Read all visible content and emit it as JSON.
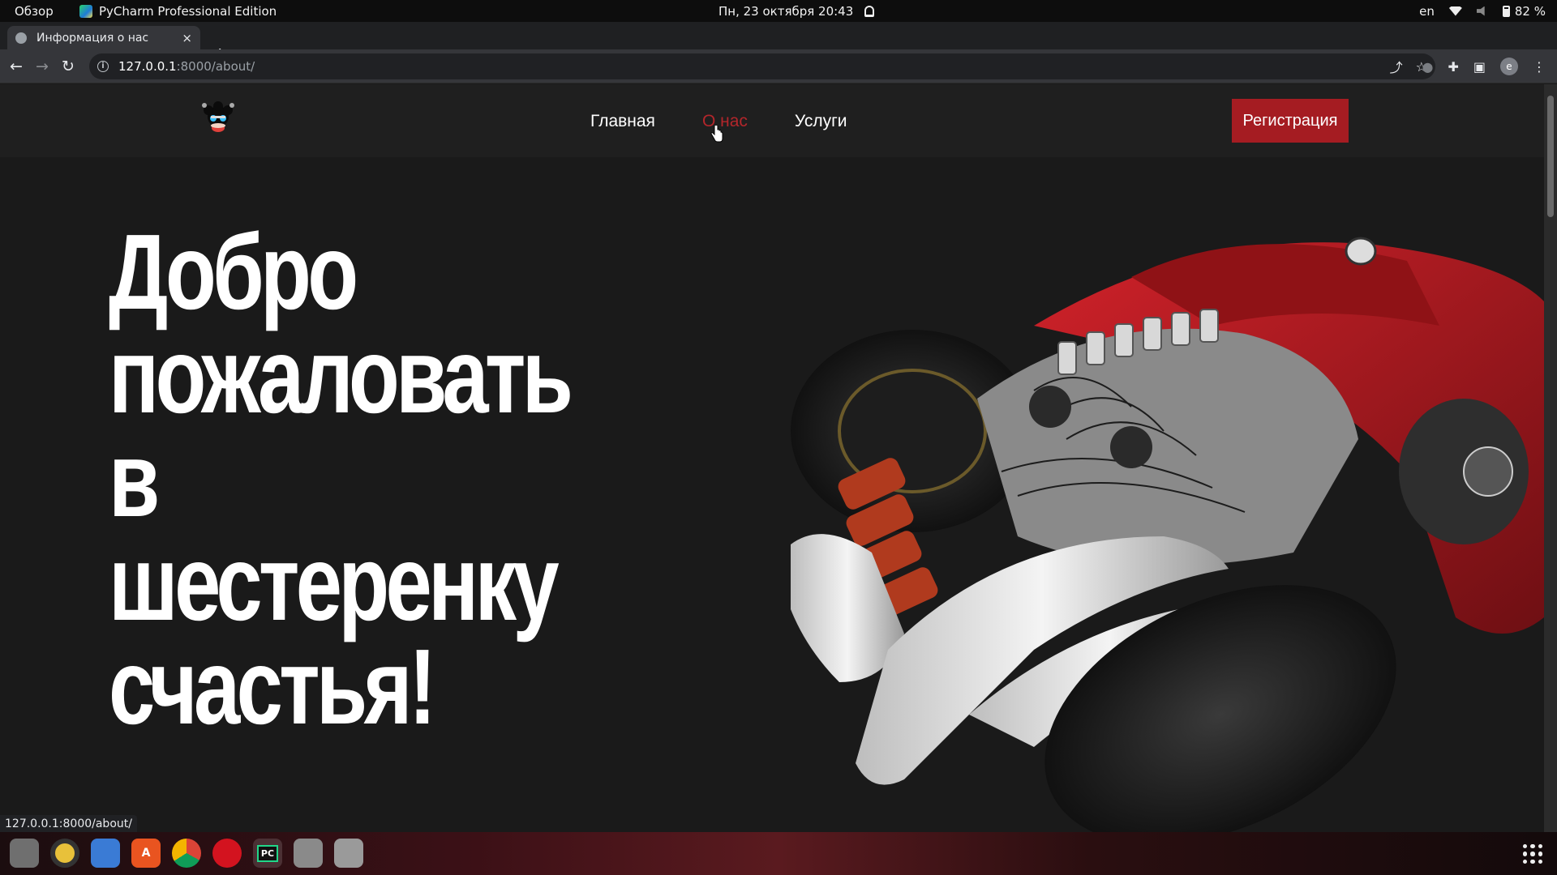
{
  "system_bar": {
    "overview": "Обзор",
    "active_app": "PyCharm Professional Edition",
    "clock": "Пн, 23 октября  20:43",
    "lang": "en",
    "battery": "82 %"
  },
  "browser": {
    "tab_title": "Информация о нас",
    "tab_close": "×",
    "new_tab": "+",
    "url_host": "127.0.0.1",
    "url_path": ":8000/about/",
    "status_url": "127.0.0.1:8000/about/",
    "avatar_letter": "e"
  },
  "site": {
    "nav": [
      "Главная",
      "О нас",
      "Услуги"
    ],
    "active_nav": "О нас",
    "register_label": "Регистрация",
    "hero_title": "Добро\nпожаловать\nв\nшестеренку\nсчастья!"
  },
  "dock": {
    "apps": [
      "files-icon",
      "rhythmbox-icon",
      "text-editor-icon",
      "software-icon",
      "chrome-icon",
      "opera-icon",
      "pycharm-icon",
      "file-manager-icon",
      "trash-icon"
    ],
    "pycharm_label": "PC"
  },
  "colors": {
    "accent": "#a51c22",
    "active_link": "#b3262b",
    "page_bg": "#1a1a1a"
  }
}
